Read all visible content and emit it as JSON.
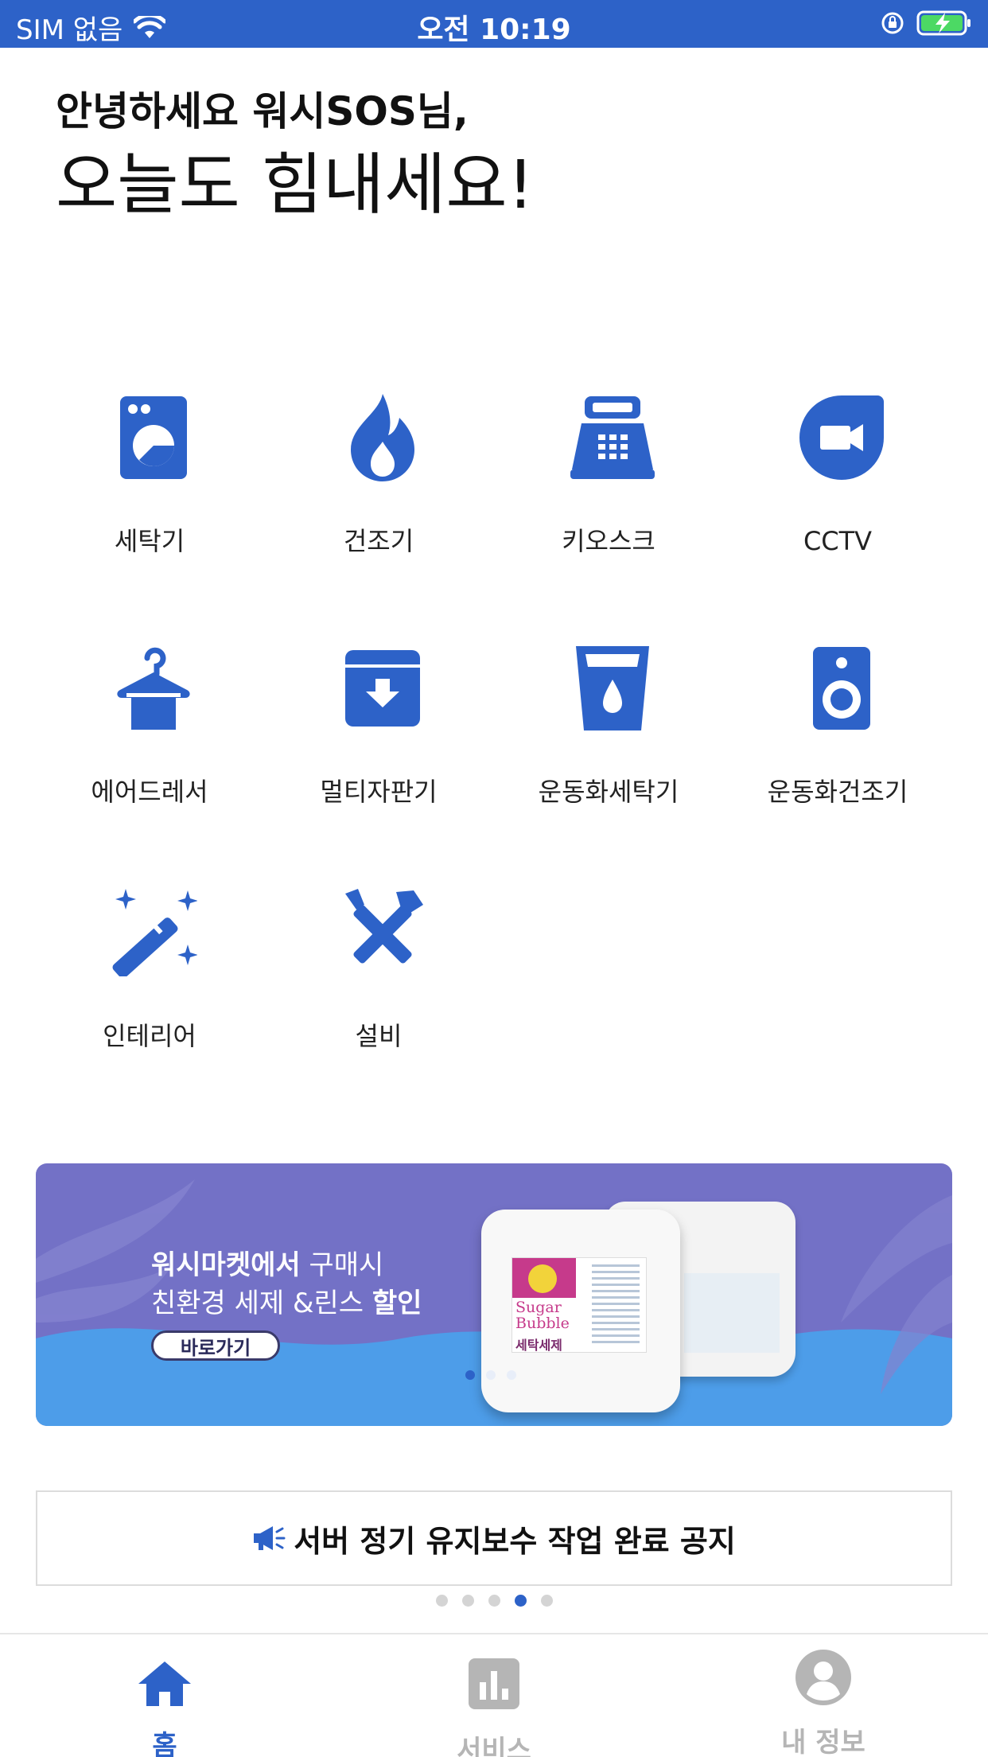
{
  "status_bar": {
    "carrier": "SIM 없음",
    "time": "오전 10:19"
  },
  "greeting": {
    "line1": "안녕하세요 워시SOS님,",
    "line2": "오늘도 힘내세요!"
  },
  "categories": [
    {
      "label": "세탁기",
      "icon": "washing-machine-icon"
    },
    {
      "label": "건조기",
      "icon": "flame-icon"
    },
    {
      "label": "키오스크",
      "icon": "kiosk-icon"
    },
    {
      "label": "CCTV",
      "icon": "video-camera-icon"
    },
    {
      "label": "에어드레서",
      "icon": "hanger-icon"
    },
    {
      "label": "멀티자판기",
      "icon": "archive-box-icon"
    },
    {
      "label": "운동화세탁기",
      "icon": "cup-drop-icon"
    },
    {
      "label": "운동화건조기",
      "icon": "speaker-icon"
    },
    {
      "label": "인테리어",
      "icon": "magic-wand-icon"
    },
    {
      "label": "설비",
      "icon": "tools-icon"
    }
  ],
  "banner": {
    "line1_bold": "워시마켓에서",
    "line1_rest": " 구매시",
    "line2_rest": "친환경 세제 &린스 ",
    "line2_bold": "할인",
    "button_label": "바로가기",
    "product_text_1": "Sugar",
    "product_text_2": "Bubble",
    "product_text_3": "세탁세제",
    "dots_count": 3,
    "active_dot": 0
  },
  "notice": {
    "text": "서버 정기 유지보수 작업 완료 공지",
    "dots_count": 5,
    "active_dot": 3
  },
  "tabbar": {
    "items": [
      {
        "label": "홈",
        "active": true
      },
      {
        "label": "서비스",
        "active": false
      },
      {
        "label": "내 정보",
        "active": false
      }
    ]
  },
  "colors": {
    "accent": "#2d62c8",
    "banner_bg": "#7371c6",
    "banner_wave": "#4d9de9",
    "inactive": "#b5b5b5"
  }
}
